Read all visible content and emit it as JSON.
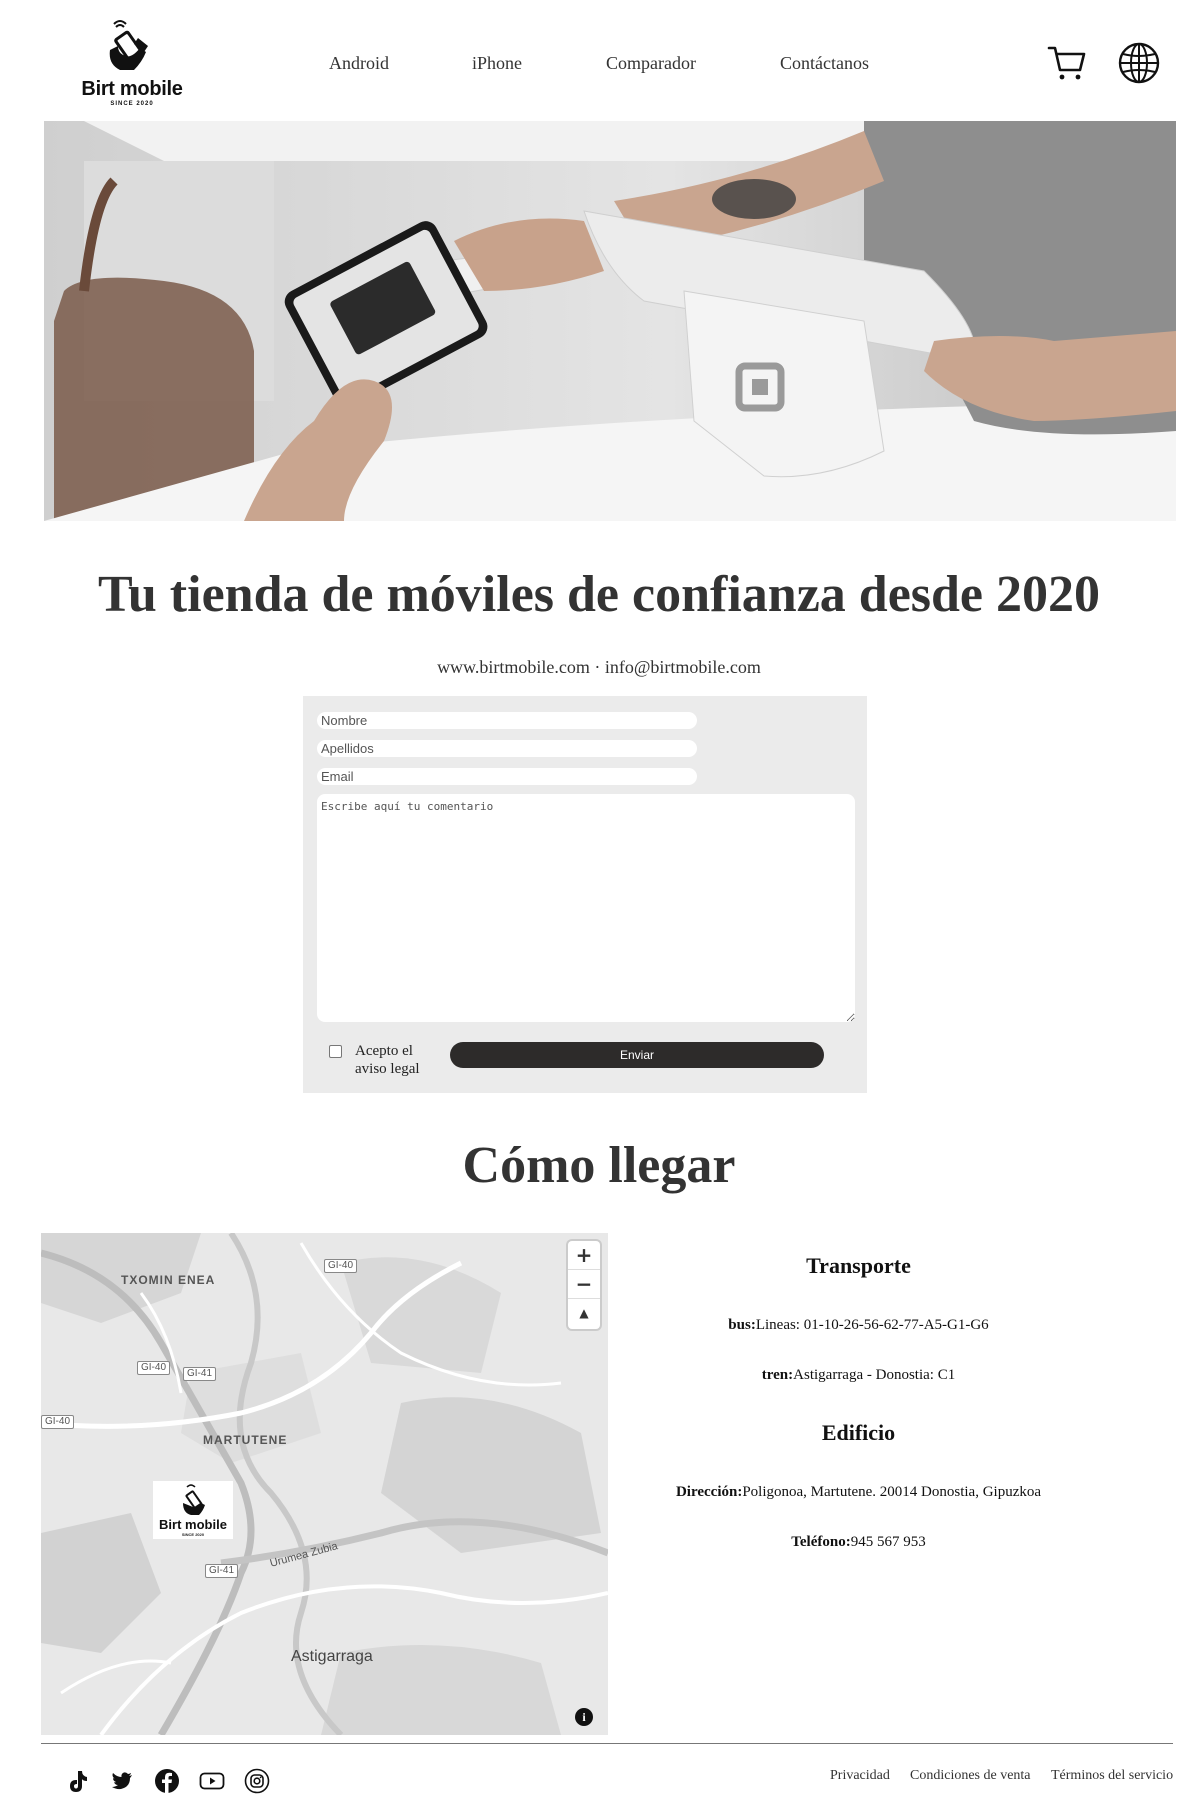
{
  "brand": {
    "name": "Birt mobile",
    "tagline": "SINCE 2020"
  },
  "nav": {
    "items": [
      "Android",
      "iPhone",
      "Comparador",
      "Contáctanos"
    ]
  },
  "header_icons": [
    "cart-icon",
    "globe-icon"
  ],
  "hero": {
    "description": "hand paying with smartphone on card terminal"
  },
  "headline": "Tu tienda de móviles de confianza desde 2020",
  "contact_line": "www.birtmobile.com · info@birtmobile.com",
  "form": {
    "name_placeholder": "Nombre",
    "surname_placeholder": "Apellidos",
    "email_placeholder": "Email",
    "comment_placeholder": "Escribe aquí tu comentario",
    "legal_label": "Acepto el aviso legal",
    "submit_label": "Enviar"
  },
  "how_to_get": {
    "title": "Cómo llegar",
    "map": {
      "labels": [
        "TXOMIN ENEA",
        "MARTUTENE",
        "Astigarraga",
        "Urumea Zubia"
      ],
      "roads": [
        "GI-40",
        "GI-40",
        "GI-41",
        "GI-40",
        "GI-41"
      ],
      "zoom_in": "+",
      "zoom_out": "−",
      "compass": "▲",
      "info": "i",
      "marker_brand": "Birt mobile",
      "marker_sub": "SINCE 2020"
    },
    "transport": {
      "title": "Transporte",
      "bus_label": "bus:",
      "bus_value": "Lineas: 01-10-26-56-62-77-A5-G1-G6",
      "train_label": "tren:",
      "train_value": "Astigarraga - Donostia: C1"
    },
    "building": {
      "title": "Edificio",
      "address_label": "Dirección:",
      "address_value": "Poligonoa, Martutene. 20014 Donostia, Gipuzkoa",
      "phone_label": "Teléfono:",
      "phone_value": "945 567 953"
    }
  },
  "footer": {
    "social": [
      "tiktok-icon",
      "twitter-icon",
      "facebook-icon",
      "youtube-icon",
      "instagram-icon"
    ],
    "links": [
      "Privacidad",
      "Condiciones de venta",
      "Términos del servicio"
    ]
  }
}
